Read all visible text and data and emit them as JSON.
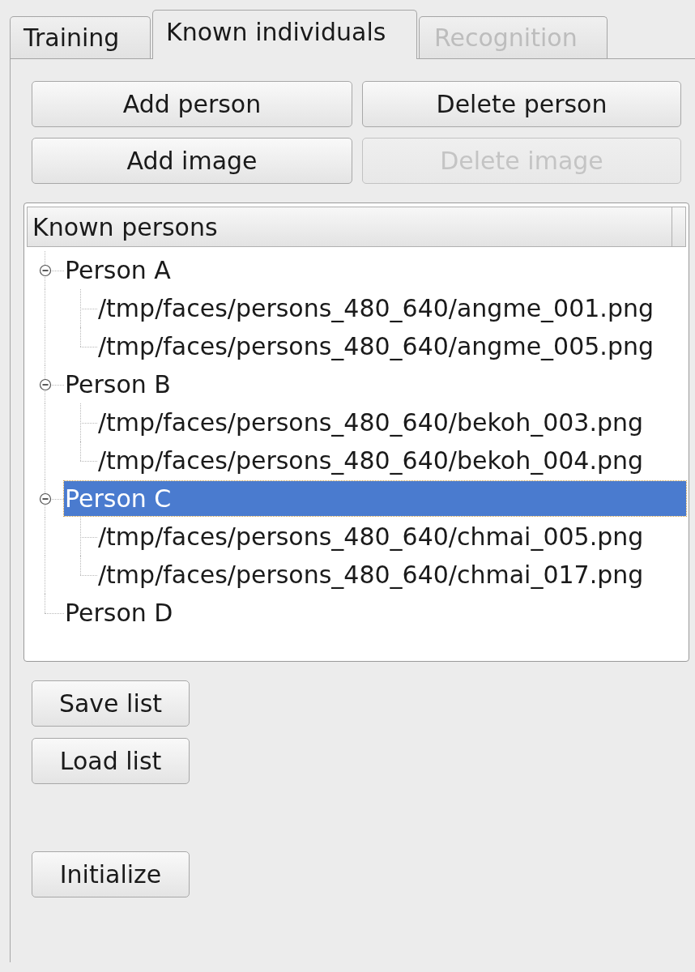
{
  "tabs": [
    {
      "label": "Training",
      "selected": false,
      "disabled": false
    },
    {
      "label": "Known individuals",
      "selected": true,
      "disabled": false
    },
    {
      "label": "Recognition",
      "selected": false,
      "disabled": true
    }
  ],
  "action_buttons": [
    {
      "label": "Add person",
      "disabled": false
    },
    {
      "label": "Delete person",
      "disabled": false
    },
    {
      "label": "Add image",
      "disabled": false
    },
    {
      "label": "Delete image",
      "disabled": true
    }
  ],
  "tree": {
    "header": "Known persons",
    "items": [
      {
        "label": "Person A",
        "expanded": true,
        "selected": false,
        "children": [
          {
            "label": "/tmp/faces/persons_480_640/angme_001.png",
            "selected": false
          },
          {
            "label": "/tmp/faces/persons_480_640/angme_005.png",
            "selected": false
          }
        ]
      },
      {
        "label": "Person B",
        "expanded": true,
        "selected": false,
        "children": [
          {
            "label": "/tmp/faces/persons_480_640/bekoh_003.png",
            "selected": false
          },
          {
            "label": "/tmp/faces/persons_480_640/bekoh_004.png",
            "selected": false
          }
        ]
      },
      {
        "label": "Person C",
        "expanded": true,
        "selected": true,
        "children": [
          {
            "label": "/tmp/faces/persons_480_640/chmai_005.png",
            "selected": false
          },
          {
            "label": "/tmp/faces/persons_480_640/chmai_017.png",
            "selected": false
          }
        ]
      },
      {
        "label": "Person D",
        "selected": false
      }
    ]
  },
  "list_buttons": [
    {
      "label": "Save list"
    },
    {
      "label": "Load list"
    }
  ],
  "initialize_button": {
    "label": "Initialize"
  }
}
